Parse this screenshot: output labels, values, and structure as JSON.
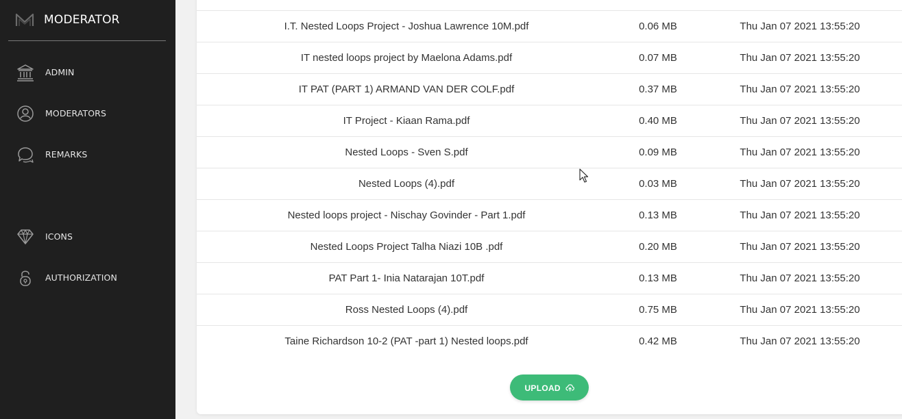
{
  "sidebar": {
    "brand": "MODERATOR",
    "logo_icon": "m-logo-icon",
    "items": [
      {
        "label": "ADMIN",
        "icon": "bank-icon"
      },
      {
        "label": "MODERATORS",
        "icon": "user-circle-icon"
      },
      {
        "label": "REMARKS",
        "icon": "chat-bubbles-icon"
      },
      {
        "label": "ICONS",
        "icon": "diamond-icon"
      },
      {
        "label": "AUTHORIZATION",
        "icon": "padlock-icon"
      }
    ]
  },
  "files": [
    {
      "name": "I.T. Nested Loops Project - Joshua Lawrence 10M.pdf",
      "size": "0.06 MB",
      "date": "Thu Jan 07 2021 13:55:20"
    },
    {
      "name": "IT nested loops project by Maelona Adams.pdf",
      "size": "0.07 MB",
      "date": "Thu Jan 07 2021 13:55:20"
    },
    {
      "name": "IT PAT (PART 1) ARMAND VAN DER COLF.pdf",
      "size": "0.37 MB",
      "date": "Thu Jan 07 2021 13:55:20"
    },
    {
      "name": "IT Project - Kiaan Rama.pdf",
      "size": "0.40 MB",
      "date": "Thu Jan 07 2021 13:55:20"
    },
    {
      "name": "Nested Loops - Sven S.pdf",
      "size": "0.09 MB",
      "date": "Thu Jan 07 2021 13:55:20"
    },
    {
      "name": "Nested Loops (4).pdf",
      "size": "0.03 MB",
      "date": "Thu Jan 07 2021 13:55:20"
    },
    {
      "name": "Nested loops project - Nischay Govinder - Part 1.pdf",
      "size": "0.13 MB",
      "date": "Thu Jan 07 2021 13:55:20"
    },
    {
      "name": "Nested Loops Project Talha Niazi 10B .pdf",
      "size": "0.20 MB",
      "date": "Thu Jan 07 2021 13:55:20"
    },
    {
      "name": "PAT Part 1- Inia Natarajan 10T.pdf",
      "size": "0.13 MB",
      "date": "Thu Jan 07 2021 13:55:20"
    },
    {
      "name": "Ross Nested Loops (4).pdf",
      "size": "0.75 MB",
      "date": "Thu Jan 07 2021 13:55:20"
    },
    {
      "name": "Taine Richardson 10-2 (PAT -part 1) Nested loops.pdf",
      "size": "0.42 MB",
      "date": "Thu Jan 07 2021 13:55:20"
    }
  ],
  "upload": {
    "label": "UPLOAD",
    "icon": "cloud-upload-icon",
    "color": "#3dbb78"
  },
  "colors": {
    "sidebar_bg": "#1f1f1f",
    "accent": "#3dbb78"
  }
}
